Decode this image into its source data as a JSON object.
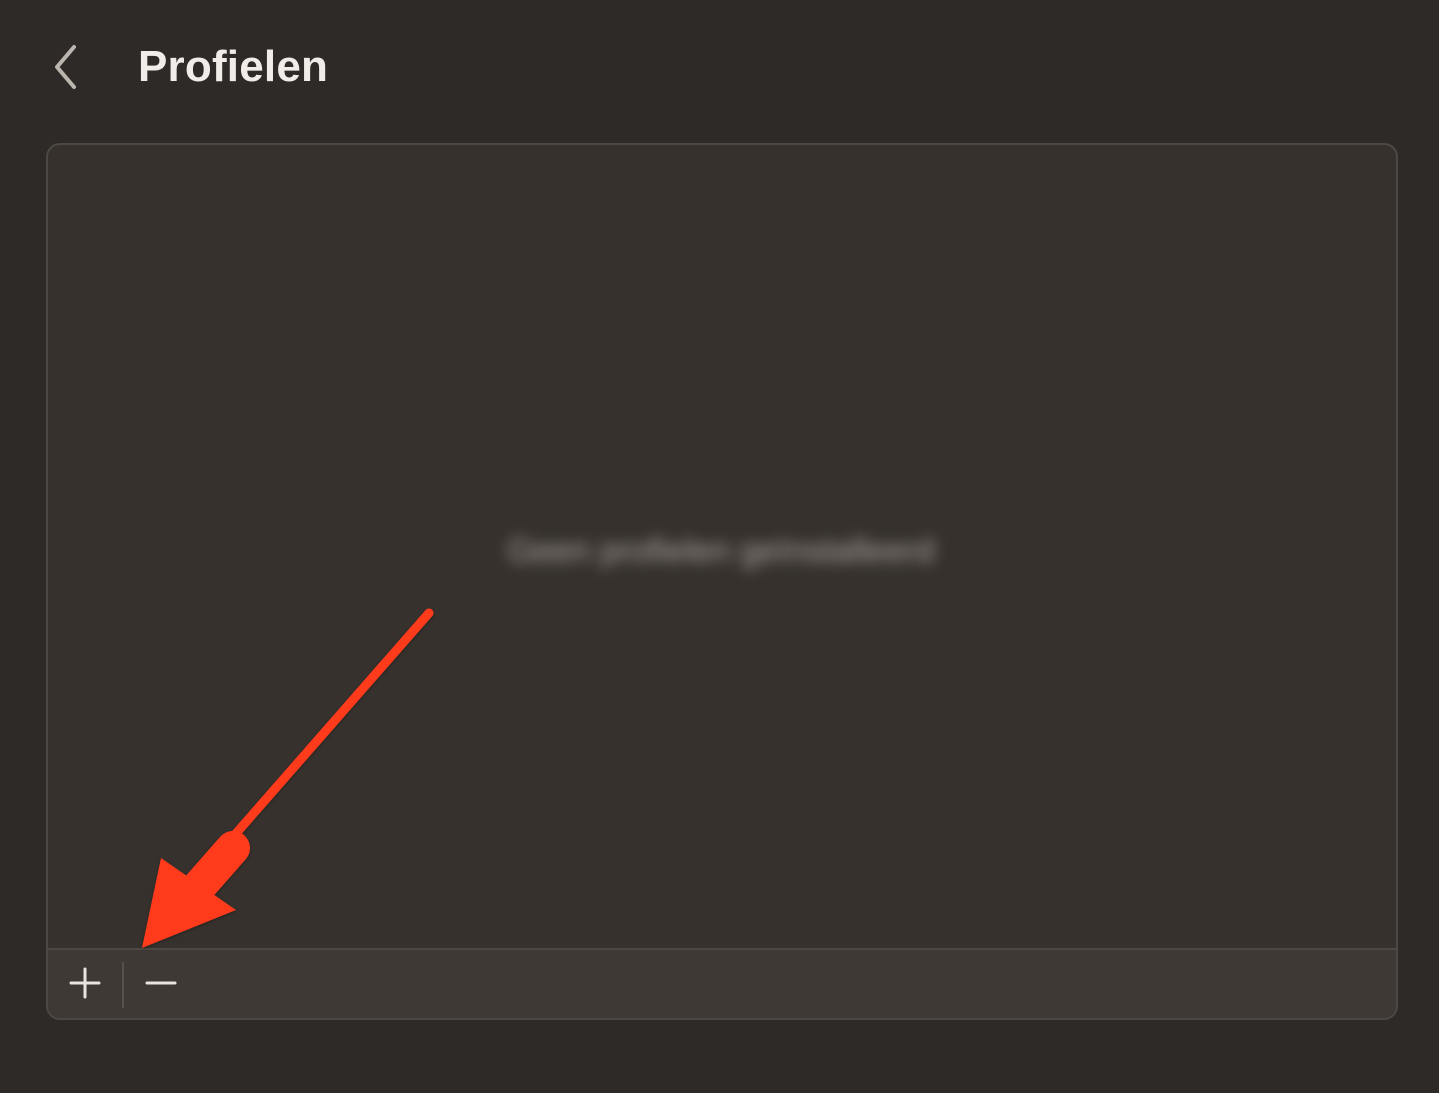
{
  "header": {
    "back_icon": "chevron-left-icon",
    "title": "Profielen"
  },
  "panel": {
    "placeholder_text": "Geen profielen geïnstalleerd",
    "toolbar": {
      "add_label": "+",
      "remove_label": "−",
      "add_icon": "plus-icon",
      "remove_icon": "minus-icon"
    }
  },
  "annotation": {
    "type": "arrow",
    "color": "#ff3b1f",
    "points_to": "add-button"
  },
  "colors": {
    "background": "#2e2a27",
    "panel": "#36312d",
    "toolbar": "#3e3934",
    "border": "#4d4843",
    "text": "#f1ece7"
  }
}
